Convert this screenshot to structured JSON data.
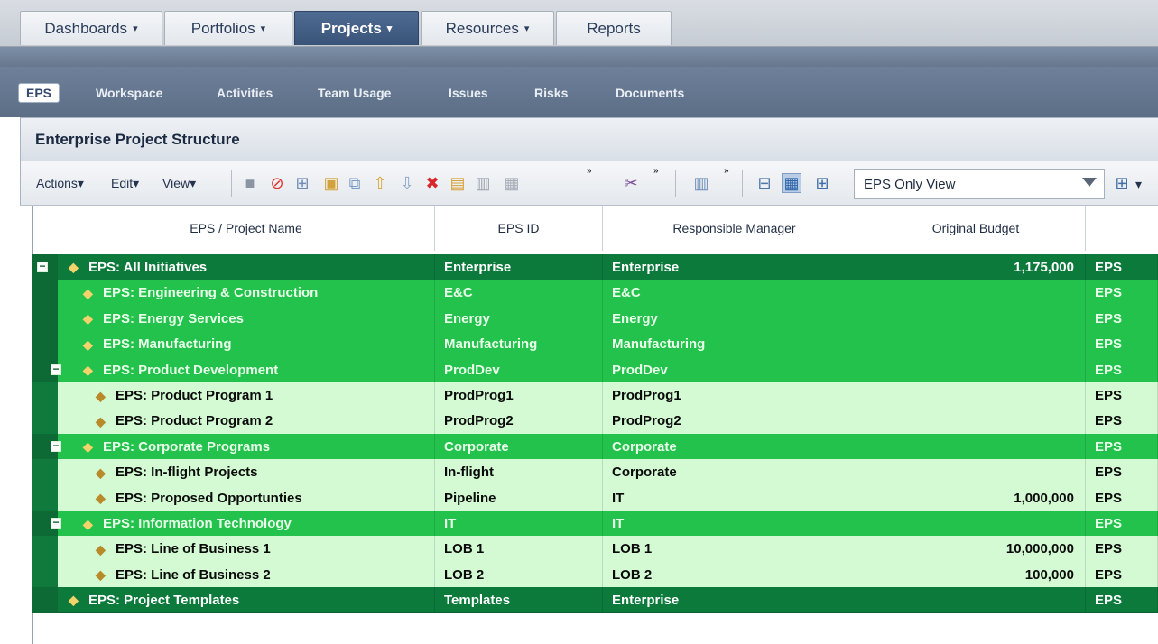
{
  "top_tabs": [
    {
      "label": "Dashboards",
      "caret": "▾"
    },
    {
      "label": "Portfolios",
      "caret": "▾"
    },
    {
      "label": "Projects",
      "caret": "▾"
    },
    {
      "label": "Resources",
      "caret": "▾"
    },
    {
      "label": "Reports",
      "caret": ""
    }
  ],
  "sub_nav": [
    "EPS",
    "Workspace",
    "Activities",
    "Team Usage",
    "Issues",
    "Risks",
    "Documents"
  ],
  "section_title": "Enterprise Project Structure",
  "toolbar": {
    "actions": "Actions",
    "edit": "Edit",
    "view": "View",
    "menu_caret": "▾",
    "more": "»",
    "view_select": "EPS Only View"
  },
  "columns": [
    "EPS / Project Name",
    "EPS ID",
    "Responsible Manager",
    "Original Budget"
  ],
  "rows": [
    {
      "name": "EPS: All  Initiatives",
      "id": "Enterprise",
      "manager": "Enterprise",
      "budget": "1,175,000",
      "extra": "EPS",
      "level": 0,
      "toggle": "−"
    },
    {
      "name": "EPS: Engineering & Construction",
      "id": "E&C",
      "manager": "E&C",
      "budget": "",
      "extra": "EPS",
      "level": 1,
      "toggle": ""
    },
    {
      "name": "EPS: Energy Services",
      "id": "Energy",
      "manager": "Energy",
      "budget": "",
      "extra": "EPS",
      "level": 1,
      "toggle": ""
    },
    {
      "name": "EPS: Manufacturing",
      "id": "Manufacturing",
      "manager": "Manufacturing",
      "budget": "",
      "extra": "EPS",
      "level": 1,
      "toggle": ""
    },
    {
      "name": "EPS: Product Development",
      "id": "ProdDev",
      "manager": "ProdDev",
      "budget": "",
      "extra": "EPS",
      "level": 1,
      "toggle": "−"
    },
    {
      "name": "EPS: Product Program 1",
      "id": "ProdProg1",
      "manager": "ProdProg1",
      "budget": "",
      "extra": "EPS",
      "level": 2,
      "toggle": ""
    },
    {
      "name": "EPS: Product Program 2",
      "id": "ProdProg2",
      "manager": "ProdProg2",
      "budget": "",
      "extra": "EPS",
      "level": 2,
      "toggle": ""
    },
    {
      "name": "EPS: Corporate Programs",
      "id": "Corporate",
      "manager": "Corporate",
      "budget": "",
      "extra": "EPS",
      "level": 1,
      "toggle": "−"
    },
    {
      "name": "EPS: In-flight Projects",
      "id": "In-flight",
      "manager": "Corporate",
      "budget": "",
      "extra": "EPS",
      "level": 2,
      "toggle": ""
    },
    {
      "name": "EPS: Proposed Opportunties",
      "id": "Pipeline",
      "manager": "IT",
      "budget": "1,000,000",
      "extra": "EPS",
      "level": 2,
      "toggle": ""
    },
    {
      "name": "EPS: Information Technology",
      "id": "IT",
      "manager": "IT",
      "budget": "",
      "extra": "EPS",
      "level": 1,
      "toggle": "−"
    },
    {
      "name": "EPS: Line of Business 1",
      "id": "LOB 1",
      "manager": "LOB 1",
      "budget": "10,000,000",
      "extra": "EPS",
      "level": 2,
      "toggle": ""
    },
    {
      "name": "EPS: Line of Business 2",
      "id": "LOB 2",
      "manager": "LOB 2",
      "budget": "100,000",
      "extra": "EPS",
      "level": 2,
      "toggle": ""
    },
    {
      "name": "EPS: Project Templates",
      "id": "Templates",
      "manager": "Enterprise",
      "budget": "",
      "extra": "EPS",
      "level": 0,
      "toggle": ""
    }
  ],
  "colors": {
    "level0": "#0b7a3b",
    "level1": "#22c24d",
    "level2": "#d3fad3",
    "active_tab": "#3a5478"
  }
}
